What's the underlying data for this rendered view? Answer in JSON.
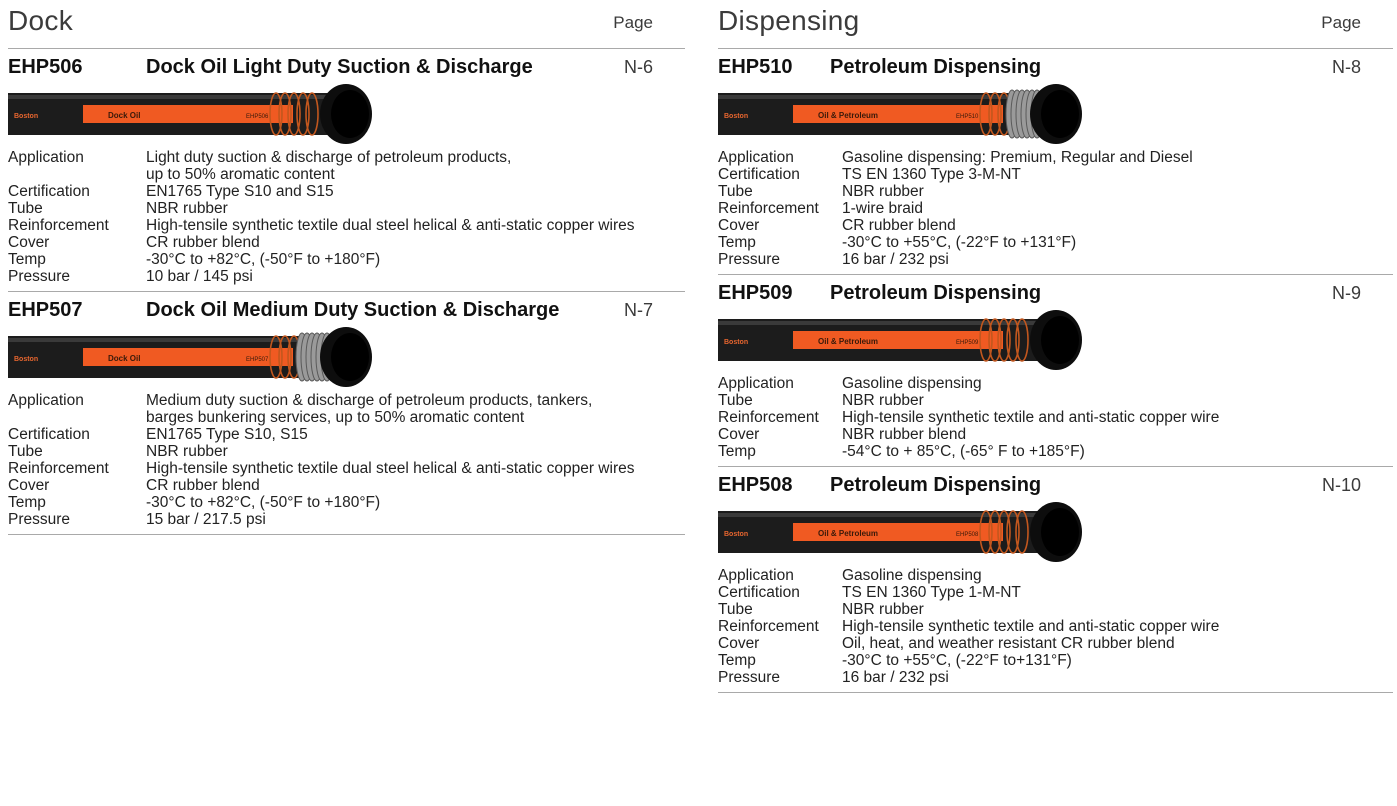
{
  "left": {
    "title": "Dock",
    "page_header": "Page",
    "products": [
      {
        "code": "EHP506",
        "name": "Dock Oil Light Duty Suction & Discharge",
        "page": "N-6",
        "hose": {
          "brand": "Boston",
          "label": "Dock Oil",
          "code": "EHP506",
          "braided": false
        },
        "specs": [
          {
            "label": "Application",
            "value": "Light duty suction & discharge of petroleum products,"
          },
          {
            "label": "",
            "value": "up to 50% aromatic content"
          },
          {
            "label": "Certification",
            "value": "EN1765 Type S10 and S15"
          },
          {
            "label": "Tube",
            "value": "NBR rubber"
          },
          {
            "label": "Reinforcement",
            "value": "High-tensile synthetic textile dual steel helical & anti-static copper wires"
          },
          {
            "label": "Cover",
            "value": "CR rubber blend"
          },
          {
            "label": "Temp",
            "value": "-30°C to +82°C, (-50°F to +180°F)"
          },
          {
            "label": "Pressure",
            "value": "10 bar / 145 psi"
          }
        ]
      },
      {
        "code": "EHP507",
        "name": "Dock Oil Medium Duty Suction & Discharge",
        "page": "N-7",
        "hose": {
          "brand": "Boston",
          "label": "Dock Oil",
          "code": "EHP507",
          "braided": true
        },
        "specs": [
          {
            "label": "Application",
            "value": "Medium duty suction & discharge of petroleum products, tankers,"
          },
          {
            "label": "",
            "value": "barges bunkering services, up to 50% aromatic content"
          },
          {
            "label": "Certification",
            "value": "EN1765 Type S10, S15"
          },
          {
            "label": "Tube",
            "value": "NBR rubber"
          },
          {
            "label": "Reinforcement",
            "value": "High-tensile synthetic textile dual steel helical & anti-static copper wires"
          },
          {
            "label": "Cover",
            "value": "CR rubber blend"
          },
          {
            "label": "Temp",
            "value": "-30°C to +82°C, (-50°F to +180°F)"
          },
          {
            "label": "Pressure",
            "value": "15 bar / 217.5 psi"
          }
        ]
      }
    ]
  },
  "right": {
    "title": "Dispensing",
    "page_header": "Page",
    "products": [
      {
        "code": "EHP510",
        "name": "Petroleum Dispensing",
        "page": "N-8",
        "hose": {
          "brand": "Boston",
          "label": "Oil & Petroleum",
          "code": "EHP510",
          "braided": true
        },
        "specs": [
          {
            "label": "Application",
            "value": "Gasoline dispensing: Premium, Regular and Diesel"
          },
          {
            "label": "Certification",
            "value": "TS EN 1360 Type 3-M-NT"
          },
          {
            "label": "Tube",
            "value": "NBR rubber"
          },
          {
            "label": "Reinforcement",
            "value": "1-wire braid"
          },
          {
            "label": "Cover",
            "value": "CR rubber blend"
          },
          {
            "label": "Temp",
            "value": "-30°C to +55°C, (-22°F to +131°F)"
          },
          {
            "label": "Pressure",
            "value": "16 bar / 232 psi"
          }
        ]
      },
      {
        "code": "EHP509",
        "name": "Petroleum Dispensing",
        "page": "N-9",
        "hose": {
          "brand": "Boston",
          "label": "Oil & Petroleum",
          "code": "EHP509",
          "braided": false
        },
        "specs": [
          {
            "label": "Application",
            "value": "Gasoline dispensing"
          },
          {
            "label": "Tube",
            "value": "NBR rubber"
          },
          {
            "label": "Reinforcement",
            "value": "High-tensile synthetic textile and anti-static copper wire"
          },
          {
            "label": "Cover",
            "value": "NBR rubber blend"
          },
          {
            "label": "Temp",
            "value": "-54°C to + 85°C, (-65° F to +185°F)"
          }
        ]
      },
      {
        "code": "EHP508",
        "name": "Petroleum Dispensing",
        "page": "N-10",
        "hose": {
          "brand": "Boston",
          "label": "Oil & Petroleum",
          "code": "EHP508",
          "braided": false
        },
        "specs": [
          {
            "label": "Application",
            "value": "Gasoline dispensing"
          },
          {
            "label": "Certification",
            "value": "TS EN 1360 Type 1-M-NT"
          },
          {
            "label": "Tube",
            "value": "NBR rubber"
          },
          {
            "label": "Reinforcement",
            "value": "High-tensile synthetic textile and anti-static copper wire"
          },
          {
            "label": "Cover",
            "value": "Oil, heat, and weather resistant CR rubber blend"
          },
          {
            "label": "Temp",
            "value": "-30°C to +55°C, (-22°F to+131°F)"
          },
          {
            "label": "Pressure",
            "value": "16 bar / 232 psi"
          }
        ]
      }
    ]
  },
  "colors": {
    "hose_black": "#1c1c1c",
    "hose_orange": "#f05a22",
    "rule": "#a9a9a9"
  }
}
